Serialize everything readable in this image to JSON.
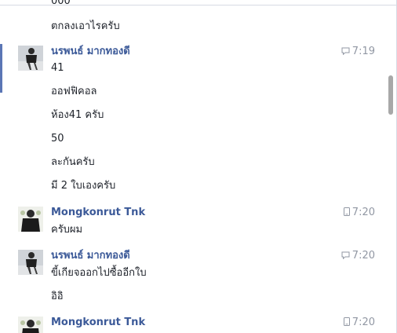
{
  "top_fragment": "000",
  "messages": [
    {
      "text": "ตกลงเอาไรครับ"
    },
    {
      "sender": "นรพนธ์ มากทองดี",
      "time": "7:19",
      "time_icon": "chat-bubble-icon",
      "lines": [
        "41",
        "ออฟฟิคอล",
        "ห้อง41 ครับ",
        "50",
        "ละกันครับ",
        "มี 2 ใบเองครับ"
      ]
    },
    {
      "sender": "Mongkonrut Tnk",
      "time": "7:20",
      "time_icon": "mobile-phone-icon",
      "lines": [
        "ครับผม"
      ]
    },
    {
      "sender": "นรพนธ์ มากทองดี",
      "time": "7:20",
      "time_icon": "chat-bubble-icon",
      "lines": [
        "ขี้เกียจออกไปซื้ออีกใบ",
        "อิอิ"
      ]
    },
    {
      "sender": "Mongkonrut Tnk",
      "time": "7:20",
      "time_icon": "mobile-phone-icon",
      "lines": []
    }
  ],
  "colors": {
    "sender_name": "#3b5998",
    "timestamp": "#9197a3",
    "message_text": "#1d2129",
    "active_bar": "#5b76b5",
    "scroll_thumb": "#a8a8a8"
  }
}
